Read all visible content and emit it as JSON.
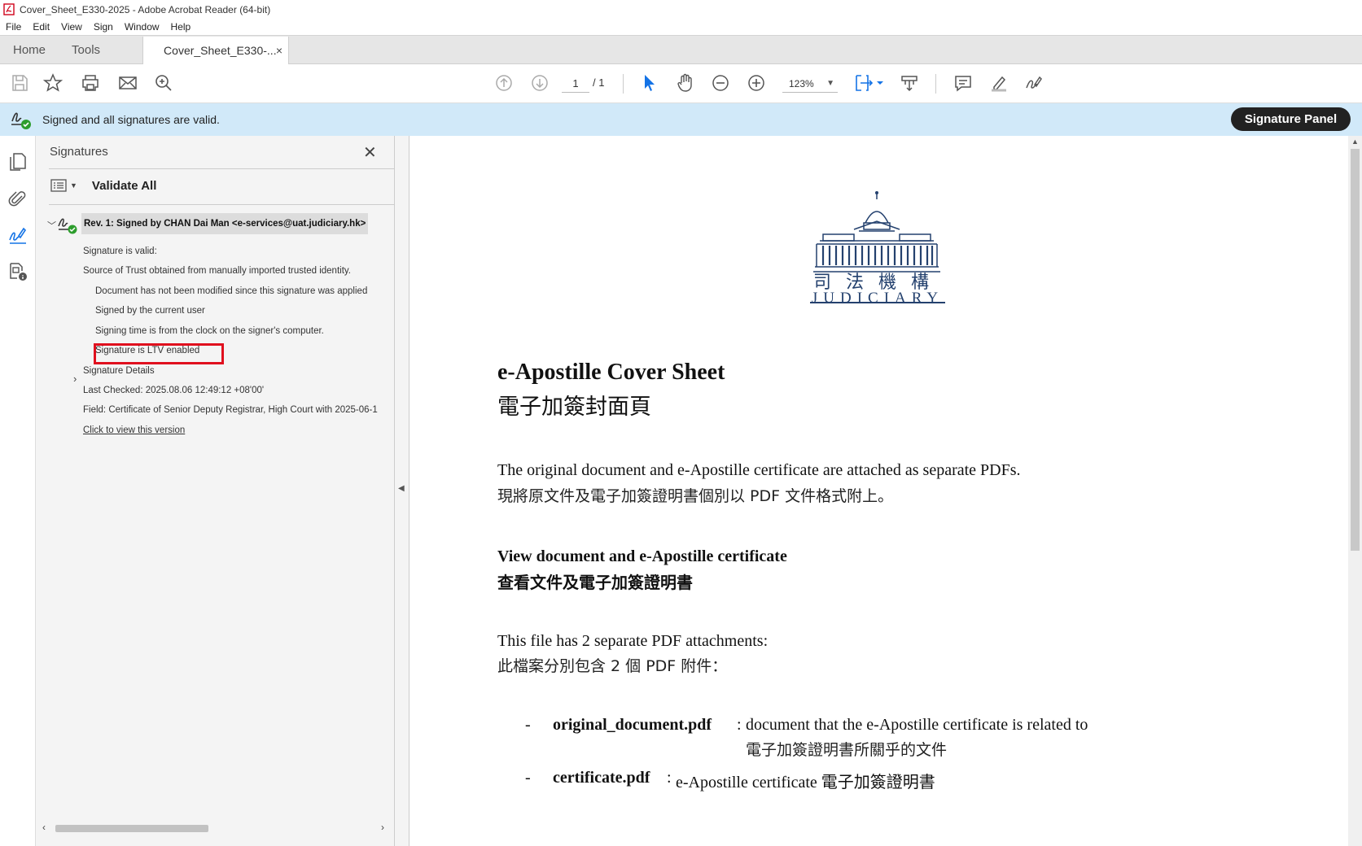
{
  "window": {
    "title": "Cover_Sheet_E330-2025 - Adobe Acrobat Reader (64-bit)"
  },
  "menu": [
    "File",
    "Edit",
    "View",
    "Sign",
    "Window",
    "Help"
  ],
  "tabs": {
    "home": "Home",
    "tools": "Tools",
    "document": "Cover_Sheet_E330-...",
    "close": "×"
  },
  "toolbar": {
    "page_current": "1",
    "page_total": "/ 1",
    "zoom": "123%"
  },
  "infobar": {
    "message": "Signed and all signatures are valid.",
    "signature_panel_button": "Signature Panel"
  },
  "signatures_panel": {
    "title": "Signatures",
    "validate_all": "Validate All",
    "revision": "Rev. 1: Signed by CHAN Dai Man <e-services@uat.judiciary.hk>",
    "details": {
      "valid": "Signature is valid:",
      "source_of_trust": "Source of Trust obtained from manually imported trusted identity.",
      "not_modified": "Document has not been modified since this signature was applied",
      "signed_by_current": "Signed by the current user",
      "signing_time": "Signing time is from the clock on the signer's computer.",
      "ltv": "Signature is LTV enabled",
      "signature_details": "Signature Details",
      "last_checked": "Last Checked: 2025.08.06 12:49:12 +08'00'",
      "field": "Field: Certificate of Senior Deputy Registrar, High Court with 2025-06-1",
      "view_version": "Click to view this version"
    }
  },
  "document": {
    "logo_zh": "司法機構",
    "logo_en": "JUDICIARY",
    "title_en": "e-Apostille Cover Sheet",
    "title_zh": "電子加簽封面頁",
    "para1_en": "The original document and e-Apostille certificate are attached as separate PDFs.",
    "para1_zh": "現將原文件及電子加簽證明書個別以 PDF 文件格式附上。",
    "heading2_en": "View document and e-Apostille certificate",
    "heading2_zh": "查看文件及電子加簽證明書",
    "para2_en": "This file has 2 separate PDF attachments:",
    "para2_zh": "此檔案分別包含 2 個 PDF 附件：",
    "bullets": [
      {
        "dash": "-",
        "name": "original_document.pdf",
        "sep": ":",
        "desc": "document that the e-Apostille certificate is related to",
        "desc_zh": "電子加簽證明書所關乎的文件"
      },
      {
        "dash": "-",
        "name": "certificate.pdf",
        "sep": ":",
        "desc": "e-Apostille certificate 電子加簽證明書"
      }
    ]
  },
  "colors": {
    "infobar_bg": "#d1e9f9",
    "highlight_box": "#e0101e",
    "logo_blue": "#24416e",
    "accent_blue": "#1473e6"
  }
}
